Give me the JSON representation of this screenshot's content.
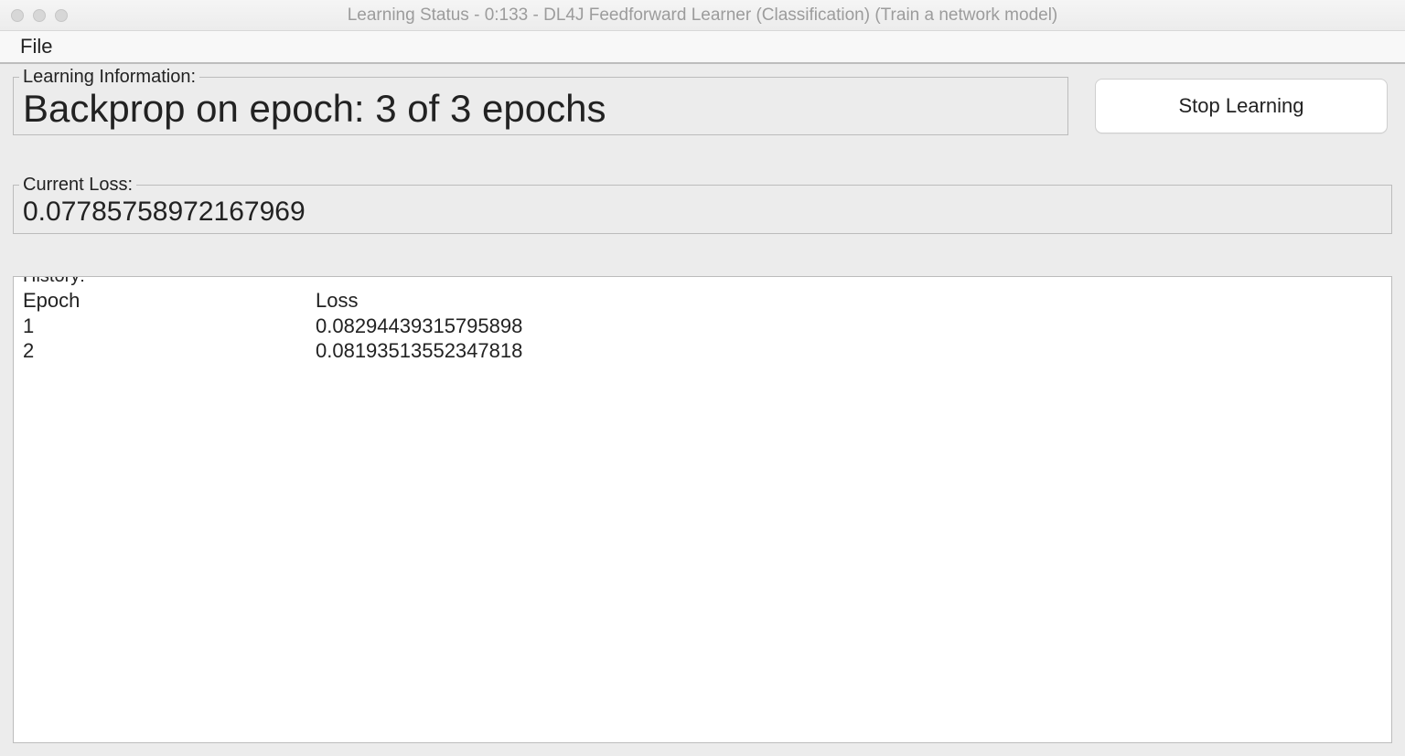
{
  "window": {
    "title": "Learning Status - 0:133 - DL4J Feedforward Learner (Classification) (Train a network model)"
  },
  "menubar": {
    "file": "File"
  },
  "learning_info": {
    "legend": "Learning Information:",
    "value": "Backprop on epoch: 3 of 3 epochs"
  },
  "buttons": {
    "stop": "Stop Learning"
  },
  "current_loss": {
    "legend": "Current Loss:",
    "value": "0.07785758972167969"
  },
  "history": {
    "legend": "History:",
    "headers": {
      "epoch": "Epoch",
      "loss": "Loss"
    },
    "rows": [
      {
        "epoch": "1",
        "loss": "0.08294439315795898"
      },
      {
        "epoch": "2",
        "loss": "0.08193513552347818"
      }
    ]
  }
}
